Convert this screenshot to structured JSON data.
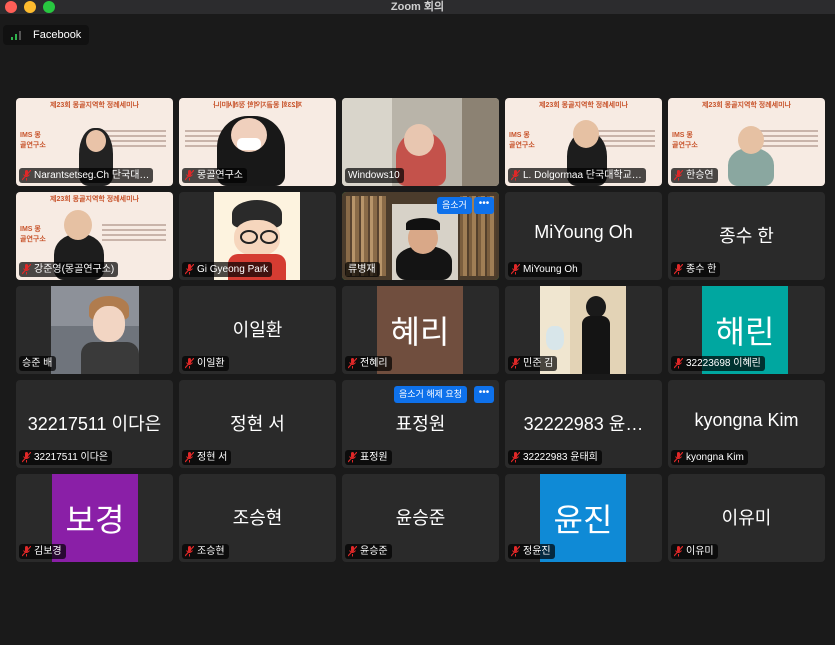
{
  "window": {
    "title": "Zoom 회의"
  },
  "stream": {
    "label": "Facebook"
  },
  "colors": {
    "active_speaker": "#2fce5b",
    "mute_red": "#e02828",
    "button_blue": "#0e71eb"
  },
  "tiles": [
    {
      "label": "Narantsetseg.Ch 단국대…",
      "slide_title": "제23회 몽골지역학 정례세미나",
      "logo": "IMS 몽골연구소"
    },
    {
      "label": "몽골연구소",
      "slide_title": "제23회 몽골지역학 정례세미나"
    },
    {
      "label": "Windows10"
    },
    {
      "label": "L. Dolgormaa 단국대학교…",
      "slide_title": "제23회 몽골지역학 정례세미나",
      "logo": "IMS 몽골연구소"
    },
    {
      "label": "한승연",
      "slide_title": "제23회 몽골지역학 정례세미나",
      "logo": "IMS 몽골연구소"
    },
    {
      "label": "강준영(몽골연구소)",
      "slide_title": "제23회 몽골지역학 정례세미나",
      "logo": "IMS 몽골연구소"
    },
    {
      "label": "Gi Gyeong Park"
    },
    {
      "label": "류병재",
      "button": "음소거"
    },
    {
      "label": "MiYoung Oh",
      "name": "MiYoung Oh"
    },
    {
      "label": "종수 한",
      "name": "종수 한"
    },
    {
      "label": "승준 배"
    },
    {
      "label": "이일환",
      "name": "이일환"
    },
    {
      "label": "전혜리",
      "avatar": "혜리"
    },
    {
      "label": "민준 김"
    },
    {
      "label": "32223698 이혜린",
      "avatar": "해린"
    },
    {
      "label": "32217511 이다은",
      "name": "32217511 이다은"
    },
    {
      "label": "정현 서",
      "name": "정현 서"
    },
    {
      "label": "표정원",
      "name": "표정원",
      "button": "음소거 해제 요청"
    },
    {
      "label": "32222983 윤태희",
      "name": "32222983 윤…"
    },
    {
      "label": "kyongna Kim",
      "name": "kyongna Kim"
    },
    {
      "label": "김보경",
      "avatar": "보경"
    },
    {
      "label": "조승현",
      "name": "조승현"
    },
    {
      "label": "윤승준",
      "name": "윤승준"
    },
    {
      "label": "정윤진",
      "avatar": "윤진"
    },
    {
      "label": "이유미",
      "name": "이유미"
    }
  ],
  "more_button": "•••"
}
